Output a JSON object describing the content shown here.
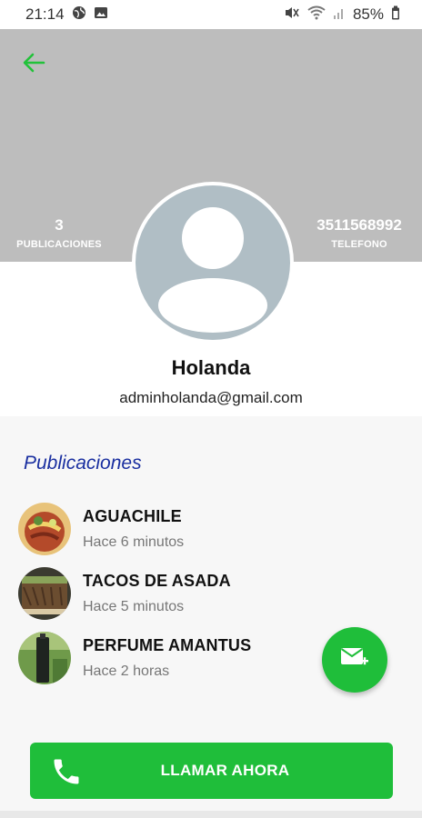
{
  "status_bar": {
    "time": "21:14",
    "battery": "85%",
    "left_icons": [
      "globe-icon",
      "image-icon"
    ],
    "right_icons": [
      "mute-icon",
      "wifi-icon",
      "signal-icon",
      "battery-icon"
    ]
  },
  "header": {
    "back_icon": "arrow-left-icon",
    "stats": {
      "publications_value": "3",
      "publications_label": "PUBLICACIONES",
      "phone_value": "3511568992",
      "phone_label": "TELEFONO"
    }
  },
  "profile": {
    "name": "Holanda",
    "email": "adminholanda@gmail.com"
  },
  "publications": {
    "title": "Publicaciones",
    "items": [
      {
        "title": "AGUACHILE",
        "time": "Hace 6 minutos"
      },
      {
        "title": "TACOS DE ASADA",
        "time": "Hace 5 minutos"
      },
      {
        "title": "PERFUME AMANTUS",
        "time": "Hace 2 horas"
      }
    ]
  },
  "fab": {
    "icon": "message-plus-icon"
  },
  "call_button": {
    "label": "LLAMAR AHORA",
    "icon": "phone-icon"
  },
  "colors": {
    "accent": "#1fbe3a",
    "header_bg": "#bdbdbd",
    "avatar_bg": "#b0bec5",
    "section_title": "#1a2fa0"
  }
}
